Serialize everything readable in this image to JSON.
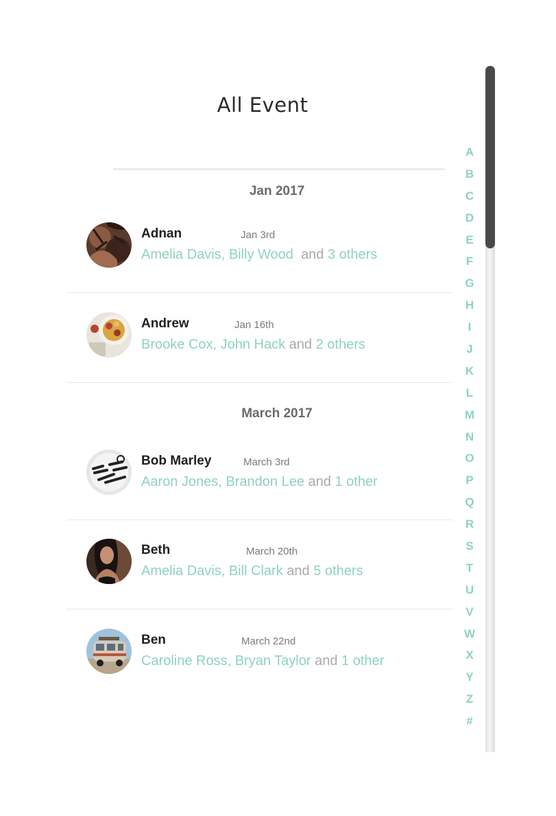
{
  "header": {
    "title": "All Event"
  },
  "sections": [
    {
      "label": "Jan 2017",
      "events": [
        {
          "name": "Adnan",
          "date": "Jan 3rd",
          "names": "Amelia Davis, Billy Wood",
          "and": "and",
          "others": "3 others"
        },
        {
          "name": "Andrew",
          "date": "Jan 16th",
          "names": "Brooke Cox, John Hack",
          "and": "and",
          "others": "2 others"
        }
      ]
    },
    {
      "label": "March 2017",
      "events": [
        {
          "name": "Bob Marley",
          "date": "March 3rd",
          "names": "Aaron Jones, Brandon Lee",
          "and": "and",
          "others": "1 other"
        },
        {
          "name": "Beth",
          "date": "March 20th",
          "names": "Amelia Davis, Bill Clark",
          "and": "and",
          "others": "5 others"
        },
        {
          "name": "Ben",
          "date": "March 22nd",
          "names": "Caroline Ross, Bryan Taylor",
          "and": "and",
          "others": "1 other"
        }
      ]
    }
  ],
  "alphabet_index": [
    "A",
    "B",
    "C",
    "D",
    "E",
    "F",
    "G",
    "H",
    "I",
    "J",
    "K",
    "L",
    "M",
    "N",
    "O",
    "P",
    "Q",
    "R",
    "S",
    "T",
    "U",
    "V",
    "W",
    "X",
    "Y",
    "Z",
    "#"
  ],
  "colors": {
    "accent": "#8dd3bc",
    "muted": "#a9a9a9",
    "text": "#1f1f1f",
    "scroll_thumb": "#4a4a4a"
  },
  "scroll": {
    "visible_fraction": 0.27,
    "position_fraction": 0.0
  }
}
